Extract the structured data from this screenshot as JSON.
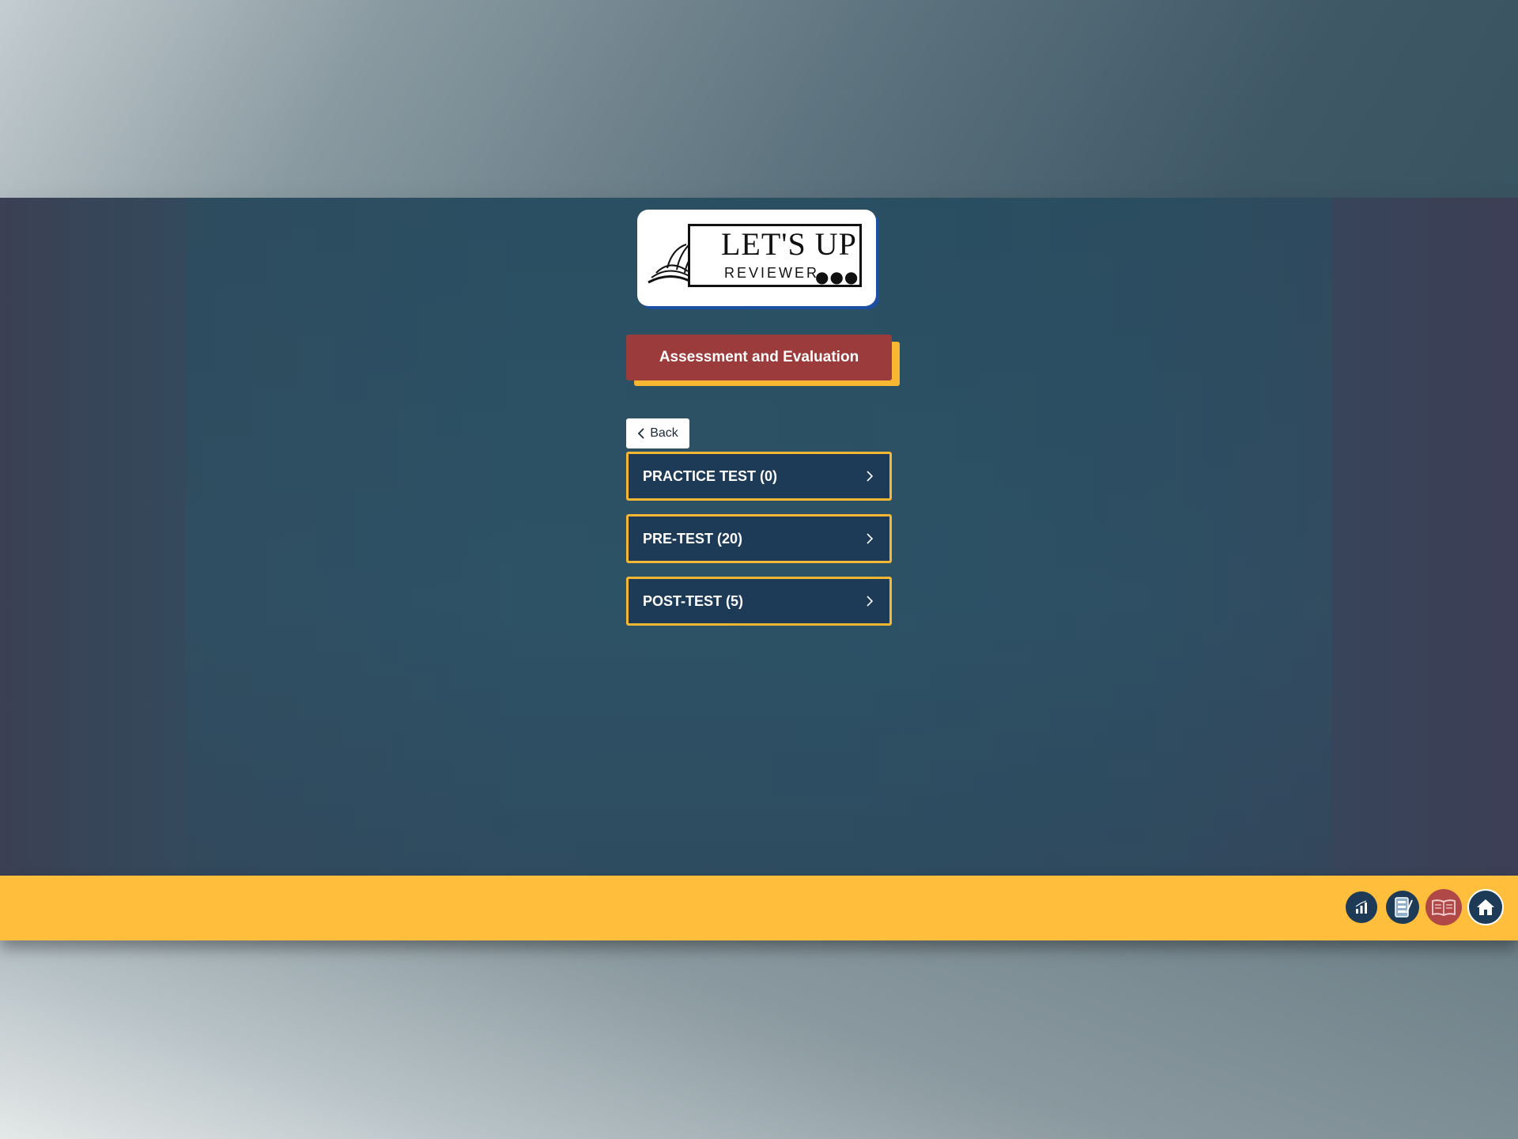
{
  "logo": {
    "main_text": "LET'S UP",
    "sub_text": "REVIEWER",
    "dots": "●●●"
  },
  "header": {
    "title": "Assessment and Evaluation"
  },
  "back_button": {
    "label": "Back"
  },
  "menu": {
    "items": [
      {
        "label": "PRACTICE TEST (0)"
      },
      {
        "label": "PRE-TEST (20)"
      },
      {
        "label": "POST-TEST (5)"
      }
    ]
  },
  "footer": {
    "icons": [
      "chart-icon",
      "checklist-icon",
      "book-icon",
      "home-icon"
    ]
  },
  "colors": {
    "accent_yellow": "#f7b733",
    "title_red": "#9b3b3b",
    "menu_blue": "#1d3a57",
    "footer_yellow": "#ffbe3b",
    "nav_navy": "#1d3a57",
    "nav_red": "#b04848"
  }
}
